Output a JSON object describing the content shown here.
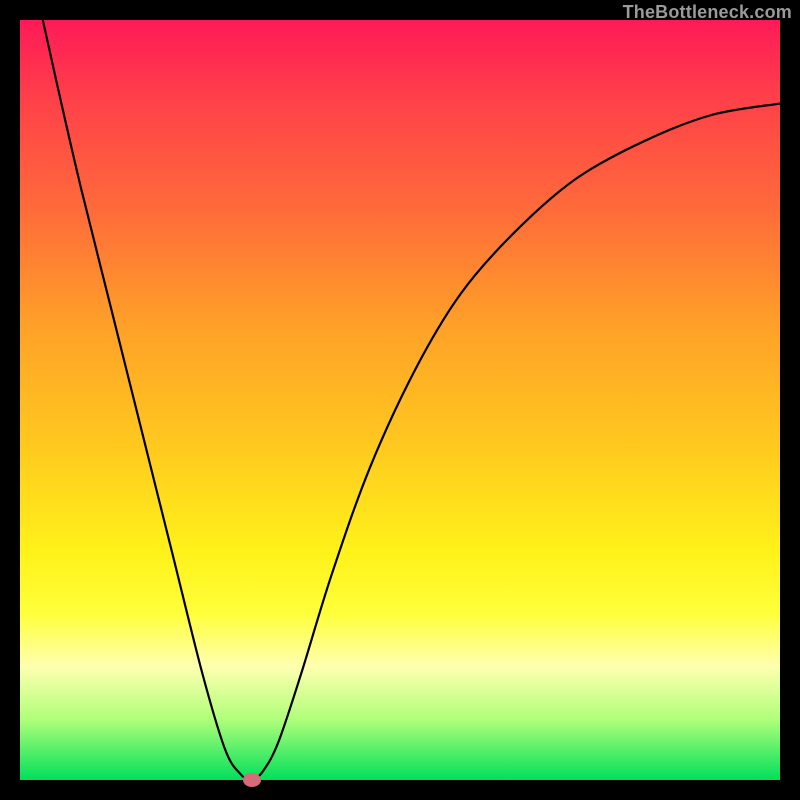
{
  "watermark": "TheBottleneck.com",
  "chart_data": {
    "type": "line",
    "title": "",
    "xlabel": "",
    "ylabel": "",
    "xlim": [
      0,
      100
    ],
    "ylim": [
      0,
      100
    ],
    "grid": false,
    "series": [
      {
        "name": "bottleneck-curve",
        "x": [
          3,
          5,
          8,
          12,
          16,
          20,
          24,
          27,
          29,
          30.5,
          32,
          34,
          37,
          41,
          46,
          52,
          58,
          65,
          73,
          82,
          91,
          100
        ],
        "y": [
          100,
          91,
          78,
          62,
          46,
          30,
          14,
          4,
          0.8,
          0,
          1.2,
          5,
          14,
          27,
          41,
          54,
          64,
          72,
          79,
          84,
          87.5,
          89
        ]
      }
    ],
    "markers": [
      {
        "name": "vertex-dot",
        "x": 30.5,
        "y": 0,
        "color": "#d86a7a"
      }
    ],
    "background_gradient": {
      "top": "#ff1a57",
      "bottom": "#00e05a"
    }
  }
}
